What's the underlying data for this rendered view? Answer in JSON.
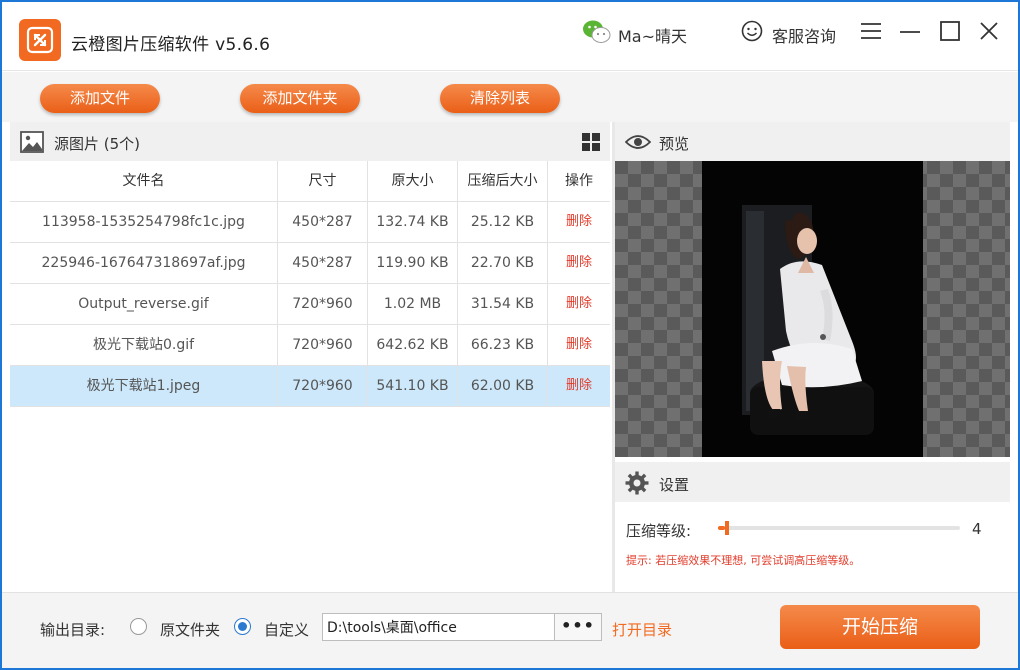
{
  "window": {
    "title": "云橙图片压缩软件 v5.6.6",
    "user_name": "Ma~晴天",
    "support_label": "客服咨询"
  },
  "toolbar": {
    "add_files": "添加文件",
    "add_folder": "添加文件夹",
    "clear_list": "清除列表"
  },
  "source": {
    "title": "源图片 (5个)",
    "columns": [
      "文件名",
      "尺寸",
      "原大小",
      "压缩后大小",
      "操作"
    ],
    "rows": [
      {
        "name": "113958-1535254798fc1c.jpg",
        "size": "450*287",
        "original": "132.74 KB",
        "compressed": "25.12 KB",
        "action": "删除"
      },
      {
        "name": "225946-167647318697af.jpg",
        "size": "450*287",
        "original": "119.90 KB",
        "compressed": "22.70 KB",
        "action": "删除"
      },
      {
        "name": "Output_reverse.gif",
        "size": "720*960",
        "original": "1.02 MB",
        "compressed": "31.54 KB",
        "action": "删除"
      },
      {
        "name": "极光下载站0.gif",
        "size": "720*960",
        "original": "642.62 KB",
        "compressed": "66.23 KB",
        "action": "删除"
      },
      {
        "name": "极光下载站1.jpeg",
        "size": "720*960",
        "original": "541.10 KB",
        "compressed": "62.00 KB",
        "action": "删除"
      }
    ],
    "selected_index": 4
  },
  "preview": {
    "title": "预览"
  },
  "settings": {
    "title": "设置",
    "level_label": "压缩等级:",
    "level_value": "4",
    "level_fraction": 0.03,
    "tip": "提示: 若压缩效果不理想, 可尝试调高压缩等级。"
  },
  "output": {
    "label": "输出目录:",
    "option_original": "原文件夹",
    "option_custom": "自定义",
    "selected": "custom",
    "path": "D:\\tools\\桌面\\office",
    "browse_label": "•••",
    "open_dir": "打开目录",
    "start": "开始压缩"
  },
  "colors": {
    "accent": "#f26a21",
    "selected_row": "#cce8fa",
    "delete_text": "#e23b2a",
    "window_border": "#1c77d6"
  }
}
